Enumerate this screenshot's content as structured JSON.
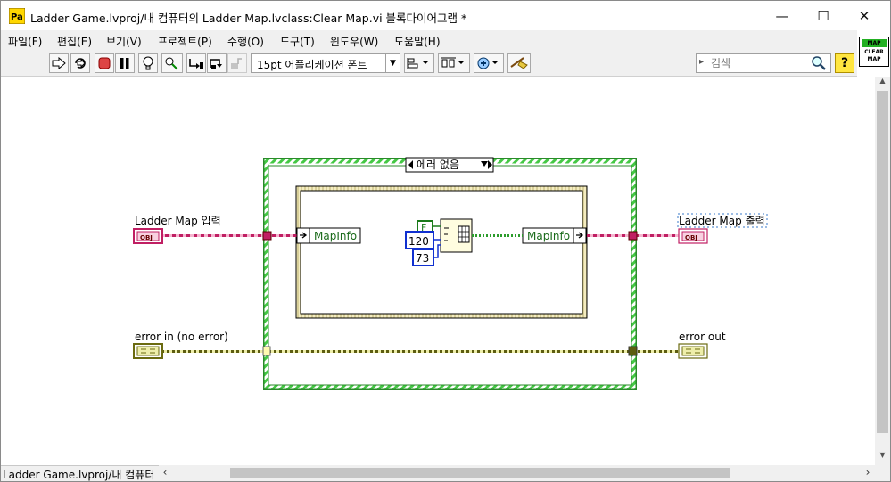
{
  "window": {
    "title": "Ladder Game.lvproj/내 컴퓨터의 Ladder Map.lvclass:Clear Map.vi 블록다이어그램 *",
    "minimize": "—",
    "maximize": "☐",
    "close": "✕"
  },
  "menu": [
    "파일(F)",
    "편집(E)",
    "보기(V)",
    "프로젝트(P)",
    "수행(O)",
    "도구(T)",
    "윈도우(W)",
    "도움말(H)"
  ],
  "toolbar": {
    "font_select": "15pt 어플리케이션 폰트",
    "search_placeholder": "검색",
    "help_label": "?"
  },
  "vi_icon": {
    "line1": "MAP",
    "line2": "CLEAR",
    "line3": "MAP"
  },
  "diagram": {
    "case_selector": "에러 없음",
    "input_label": "Ladder Map 입력",
    "output_label": "Ladder Map 출력",
    "error_in_label": "error in (no error)",
    "error_out_label": "error out",
    "obj_tag": "OBJ",
    "mapinfo_in": "MapInfo",
    "mapinfo_out": "MapInfo",
    "const_bool": "F",
    "const_rows": "120",
    "const_cols": "73"
  },
  "statusbar": {
    "hierarchy": "Ladder Game.lvproj/내 컴퓨터"
  },
  "colors": {
    "class_wire": "#d0306e",
    "error_wire": "#6b6b10",
    "case_green": "#3cc83c",
    "int_blue": "#1030d0"
  }
}
